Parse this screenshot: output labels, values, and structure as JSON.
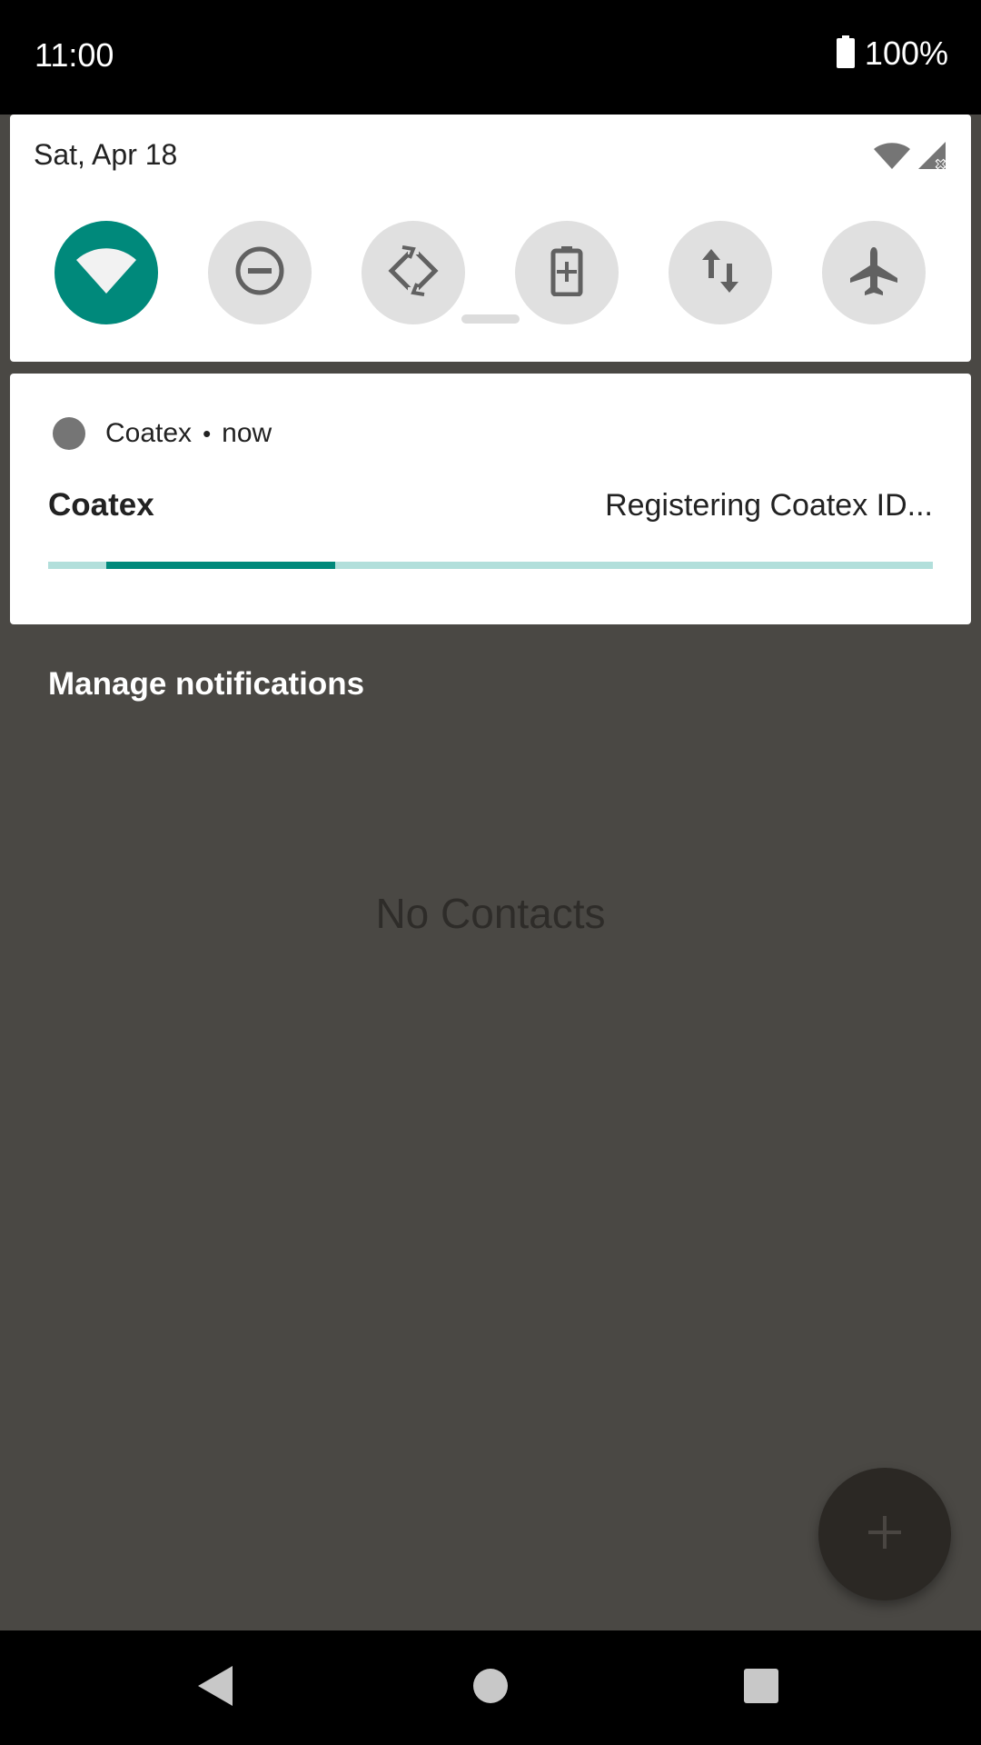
{
  "status_bar": {
    "time": "11:00",
    "battery_percent": "100%",
    "icons": [
      "battery-full-icon"
    ]
  },
  "quick_settings": {
    "date": "Sat, Apr 18",
    "indicators": [
      "wifi-icon",
      "cellular-no-signal-icon"
    ],
    "tiles": [
      {
        "name": "wifi",
        "icon": "wifi-icon",
        "active": true
      },
      {
        "name": "do-not-disturb",
        "icon": "do-not-disturb-icon",
        "active": false
      },
      {
        "name": "auto-rotate",
        "icon": "auto-rotate-icon",
        "active": false
      },
      {
        "name": "battery-saver",
        "icon": "battery-saver-icon",
        "active": false
      },
      {
        "name": "mobile-data",
        "icon": "mobile-data-icon",
        "active": false
      },
      {
        "name": "airplane-mode",
        "icon": "airplane-icon",
        "active": false
      }
    ],
    "accent_color": "#00897b"
  },
  "notification": {
    "app_name": "Coatex",
    "separator": "•",
    "time": "now",
    "title": "Coatex",
    "text": "Registering Coatex ID...",
    "progress_indeterminate": true
  },
  "shade": {
    "manage_label": "Manage notifications"
  },
  "app": {
    "empty_text": "No Contacts",
    "fab_icon": "plus-icon"
  },
  "nav": {
    "buttons": [
      "back-icon",
      "home-icon",
      "recents-icon"
    ]
  }
}
